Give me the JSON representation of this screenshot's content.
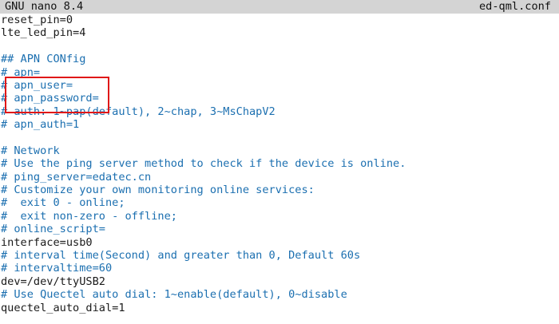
{
  "titlebar": {
    "app_name": "GNU nano 8.4",
    "file_name": "ed-qml.conf"
  },
  "lines": [
    {
      "text": "reset_pin=0",
      "kind": "code"
    },
    {
      "text": "lte_led_pin=4",
      "kind": "code"
    },
    {
      "text": "",
      "kind": "code"
    },
    {
      "text": "## APN CONfig",
      "kind": "comment"
    },
    {
      "text": "# apn=",
      "kind": "comment"
    },
    {
      "text": "# apn_user=",
      "kind": "comment"
    },
    {
      "text": "# apn_password=",
      "kind": "comment"
    },
    {
      "text": "# auth: 1~pap(default), 2~chap, 3~MsChapV2",
      "kind": "comment"
    },
    {
      "text": "# apn_auth=1",
      "kind": "comment"
    },
    {
      "text": "",
      "kind": "code"
    },
    {
      "text": "# Network",
      "kind": "comment"
    },
    {
      "text": "# Use the ping server method to check if the device is online.",
      "kind": "comment"
    },
    {
      "text": "# ping_server=edatec.cn",
      "kind": "comment"
    },
    {
      "text": "# Customize your own monitoring online services:",
      "kind": "comment"
    },
    {
      "text": "#  exit 0 - online;",
      "kind": "comment"
    },
    {
      "text": "#  exit non-zero - offline;",
      "kind": "comment"
    },
    {
      "text": "# online_script=",
      "kind": "comment"
    },
    {
      "text": "interface=usb0",
      "kind": "code"
    },
    {
      "text": "# interval time(Second) and greater than 0, Default 60s",
      "kind": "comment"
    },
    {
      "text": "# intervaltime=60",
      "kind": "comment"
    },
    {
      "text": "dev=/dev/ttyUSB2",
      "kind": "code"
    },
    {
      "text": "# Use Quectel auto dial: 1~enable(default), 0~disable",
      "kind": "comment"
    },
    {
      "text": "quectel_auto_dial=1",
      "kind": "code"
    }
  ],
  "colors": {
    "comment": "#1b6fb0",
    "code": "#1a1a1a",
    "titlebar_bg": "#d4d4d4",
    "highlight_border": "#e01818"
  }
}
